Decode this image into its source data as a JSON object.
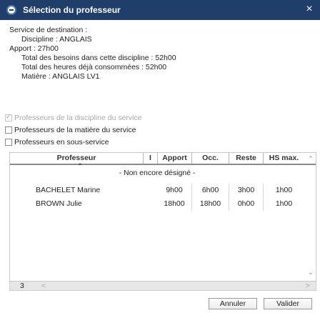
{
  "window": {
    "title": "Sélection du professeur",
    "close_glyph": "×"
  },
  "info": {
    "service_label": "Service de destination :",
    "discipline": "Discipline : ANGLAIS",
    "apport": "Apport : 27h00",
    "besoins": "Total des besoins dans cette discipline : 52h00",
    "consommees": "Total des heures déjà consommées : 52h00",
    "matiere": "Matière : ANGLAIS LV1"
  },
  "options": [
    {
      "label": "Professeurs de la discipline du service",
      "checked": true,
      "disabled": true
    },
    {
      "label": "Professeurs de la matière du service",
      "checked": false,
      "disabled": false
    },
    {
      "label": "Professeurs en sous-service",
      "checked": false,
      "disabled": false
    }
  ],
  "table": {
    "columns": [
      "Professeur",
      "I",
      "Apport",
      "Occ.",
      "Reste",
      "HS max."
    ],
    "group_row": "- Non encore désigné -",
    "rows": [
      {
        "name": "BACHELET Marine",
        "apport": "9h00",
        "occ": "6h00",
        "reste": "3h00",
        "hs": "1h00"
      },
      {
        "name": "BROWN Julie",
        "apport": "18h00",
        "occ": "18h00",
        "reste": "0h00",
        "hs": "1h00"
      }
    ]
  },
  "status": {
    "count": "3",
    "left_glyph": "<",
    "right_glyph": ">"
  },
  "buttons": {
    "cancel": "Annuler",
    "ok": "Valider"
  }
}
